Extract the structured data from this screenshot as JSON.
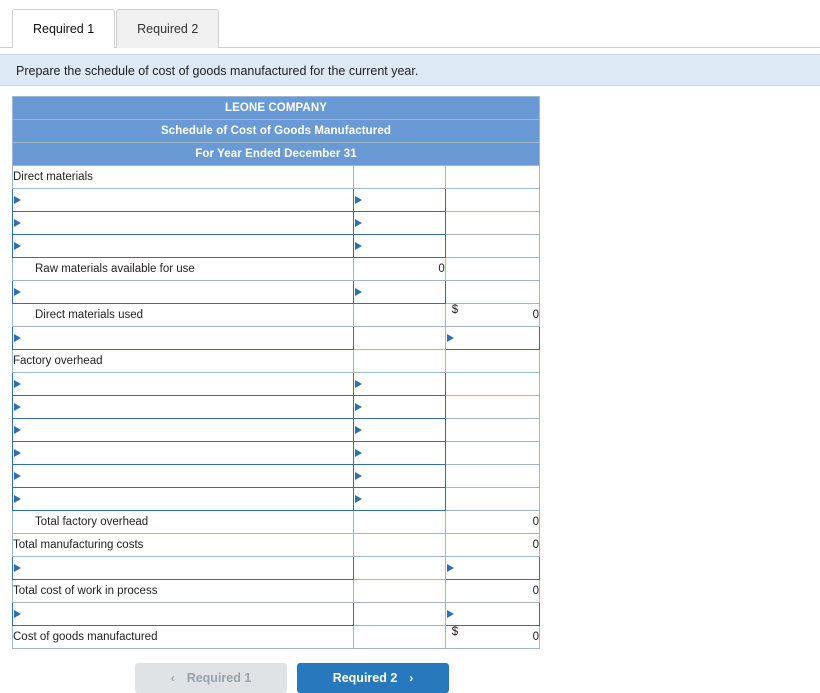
{
  "tabs": [
    {
      "label": "Required 1",
      "active": true
    },
    {
      "label": "Required 2",
      "active": false
    }
  ],
  "prompt": "Prepare the schedule of cost of goods manufactured for the current year.",
  "sheet": {
    "headers": [
      "LEONE COMPANY",
      "Schedule of Cost of Goods Manufactured",
      "For Year Ended December 31"
    ],
    "rows": [
      {
        "label": "Direct materials",
        "indent": 0,
        "label_input": false,
        "mid": "",
        "mid_input": false,
        "right": "",
        "right_input": false
      },
      {
        "label": "",
        "indent": 0,
        "label_input": true,
        "mid": "",
        "mid_input": true,
        "right": "",
        "right_input": false
      },
      {
        "label": "",
        "indent": 0,
        "label_input": true,
        "mid": "",
        "mid_input": true,
        "right": "",
        "right_input": false
      },
      {
        "label": "",
        "indent": 0,
        "label_input": true,
        "mid": "",
        "mid_input": true,
        "right": "",
        "right_input": false
      },
      {
        "label": "Raw materials available for use",
        "indent": 1,
        "label_input": false,
        "mid": "0",
        "mid_input": false,
        "right": "",
        "right_input": false
      },
      {
        "label": "",
        "indent": 0,
        "label_input": true,
        "mid": "",
        "mid_input": true,
        "right": "",
        "right_input": false
      },
      {
        "label": "Direct materials used",
        "indent": 1,
        "label_input": false,
        "mid": "",
        "mid_input": false,
        "right": "0",
        "right_input": false,
        "right_dollar": "$"
      },
      {
        "label": "",
        "indent": 0,
        "label_input": true,
        "mid": "",
        "mid_input": false,
        "right": "",
        "right_input": true
      },
      {
        "label": "Factory overhead",
        "indent": 0,
        "label_input": false,
        "mid": "",
        "mid_input": false,
        "right": "",
        "right_input": false
      },
      {
        "label": "",
        "indent": 0,
        "label_input": true,
        "mid": "",
        "mid_input": true,
        "right": "",
        "right_input": false
      },
      {
        "label": "",
        "indent": 0,
        "label_input": true,
        "mid": "",
        "mid_input": true,
        "right": "",
        "right_input": false
      },
      {
        "label": "",
        "indent": 0,
        "label_input": true,
        "mid": "",
        "mid_input": true,
        "right": "",
        "right_input": false
      },
      {
        "label": "",
        "indent": 0,
        "label_input": true,
        "mid": "",
        "mid_input": true,
        "right": "",
        "right_input": false
      },
      {
        "label": "",
        "indent": 0,
        "label_input": true,
        "mid": "",
        "mid_input": true,
        "right": "",
        "right_input": false
      },
      {
        "label": "",
        "indent": 0,
        "label_input": true,
        "mid": "",
        "mid_input": true,
        "right": "",
        "right_input": false
      },
      {
        "label": "Total factory overhead",
        "indent": 1,
        "label_input": false,
        "mid": "",
        "mid_input": false,
        "right": "0",
        "right_input": false
      },
      {
        "label": "Total manufacturing costs",
        "indent": 0,
        "label_input": false,
        "mid": "",
        "mid_input": false,
        "right": "0",
        "right_input": false
      },
      {
        "label": "",
        "indent": 0,
        "label_input": true,
        "mid": "",
        "mid_input": false,
        "right": "",
        "right_input": true
      },
      {
        "label": "Total cost of work in process",
        "indent": 0,
        "label_input": false,
        "mid": "",
        "mid_input": false,
        "right": "0",
        "right_input": false
      },
      {
        "label": "",
        "indent": 0,
        "label_input": true,
        "mid": "",
        "mid_input": false,
        "right": "",
        "right_input": true
      },
      {
        "label": "Cost of goods manufactured",
        "indent": 0,
        "label_input": false,
        "mid": "",
        "mid_input": false,
        "right": "0",
        "right_input": false,
        "right_dollar": "$"
      }
    ]
  },
  "footer": {
    "prev_label": "Required 1",
    "next_label": "Required 2",
    "prev_icon": "chevron-left-icon",
    "next_icon": "chevron-right-icon",
    "prev_chevron": "‹",
    "next_chevron": "›"
  },
  "colors": {
    "header_blue": "#6a9ad6",
    "banner_blue": "#ddeaf6",
    "input_border": "#2f6fb5",
    "primary_button": "#2878be"
  }
}
